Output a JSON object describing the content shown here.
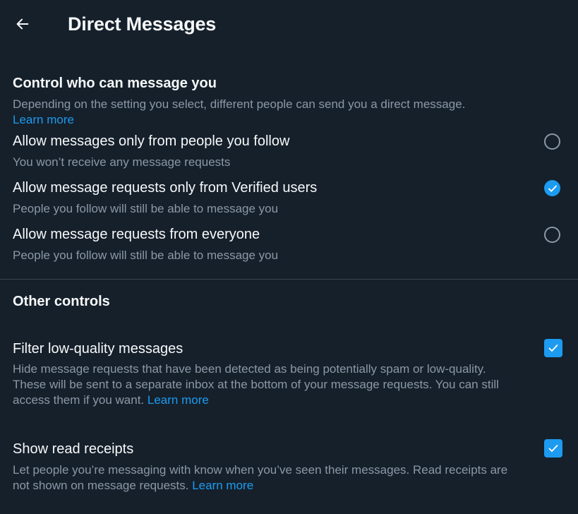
{
  "header": {
    "title": "Direct Messages",
    "back_icon": "arrow-left-icon"
  },
  "control_section": {
    "title": "Control who can message you",
    "description": "Depending on the setting you select, different people can send you a direct message.",
    "learn_more": "Learn more",
    "options": [
      {
        "label": "Allow messages only from people you follow",
        "sub": "You won’t receive any message requests",
        "selected": false
      },
      {
        "label": "Allow message requests only from Verified users",
        "sub": "People you follow will still be able to message you",
        "selected": true
      },
      {
        "label": "Allow message requests from everyone",
        "sub": "People you follow will still be able to message you",
        "selected": false
      }
    ]
  },
  "other_section": {
    "title": "Other controls",
    "filter": {
      "label": "Filter low-quality messages",
      "desc_line1": "Hide message requests that have been detected as being potentially spam or low-quality.",
      "desc_line2": "These will be sent to a separate inbox at the bottom of your message requests. You can still",
      "desc_line3": "access them if you want.",
      "learn_more": "Learn more",
      "checked": true
    },
    "receipts": {
      "label": "Show read receipts",
      "desc_line1": "Let people you’re messaging with know when you’ve seen their messages. Read receipts are",
      "desc_line2": "not shown on message requests.",
      "learn_more": "Learn more",
      "checked": true
    }
  },
  "colors": {
    "background": "#15202b",
    "accent": "#1d9bf0",
    "text_primary": "#f7f9f9",
    "text_secondary": "#8b98a5",
    "divider": "#38444d"
  }
}
